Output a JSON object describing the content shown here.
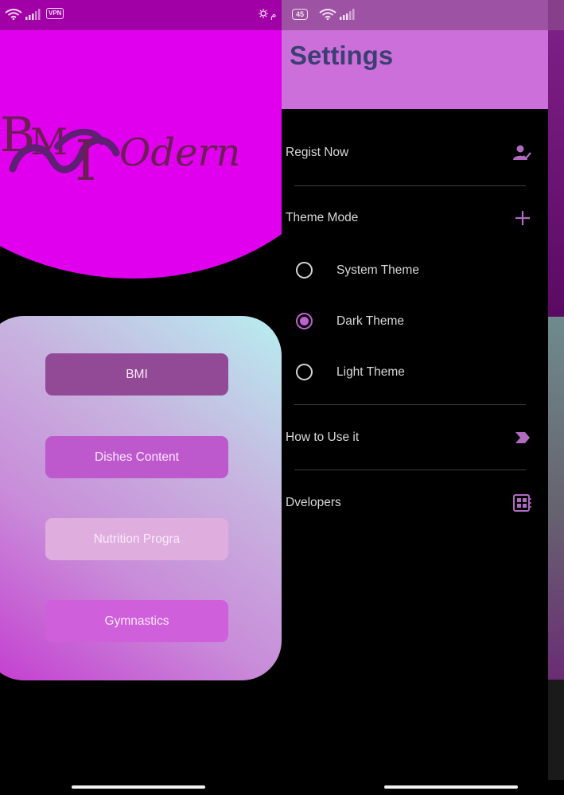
{
  "colors": {
    "accent": "#c060d0",
    "hero_magenta": "#e100ee",
    "header_bg": "#cd6fdb",
    "title_color": "#3c3f71"
  },
  "left_screen": {
    "status": {
      "vpn_label": "VPN",
      "right_text": "م"
    },
    "logo_text": "BMI Modern",
    "buttons": [
      {
        "label": "BMI"
      },
      {
        "label": "Dishes Content"
      },
      {
        "label": "Nutrition Progra"
      },
      {
        "label": "Gymnastics"
      }
    ]
  },
  "drawer": {
    "status": {
      "battery": "45"
    },
    "title": "Settings",
    "items": {
      "register": {
        "label": "Regist Now",
        "icon": "person-check-icon"
      },
      "theme_mode": {
        "label": "Theme Mode",
        "icon": "plus-icon"
      },
      "how_to_use": {
        "label": "How to Use it",
        "icon": "arrow-label-icon"
      },
      "developers": {
        "label": "Dvelopers",
        "icon": "dashboard-icon"
      }
    },
    "theme_options": [
      {
        "label": "System Theme",
        "selected": false
      },
      {
        "label": "Dark Theme",
        "selected": true
      },
      {
        "label": "Light Theme",
        "selected": false
      }
    ]
  }
}
